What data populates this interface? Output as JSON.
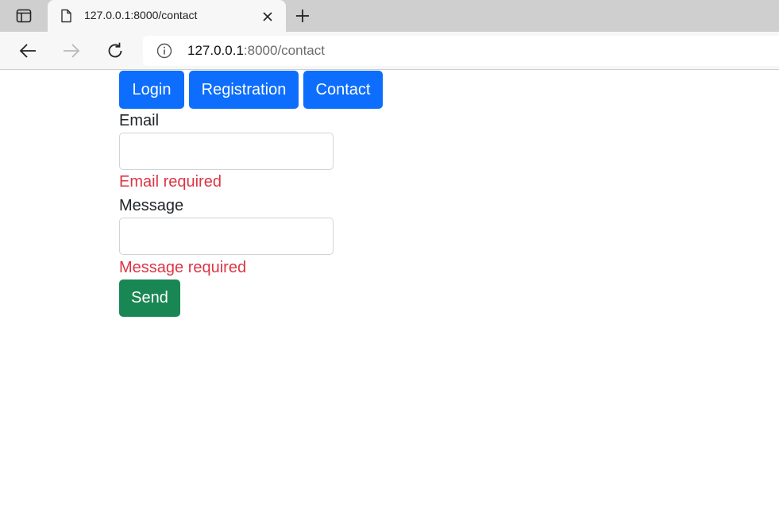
{
  "browser": {
    "tab": {
      "title": "127.0.0.1:8000/contact",
      "favicon": "page-icon"
    },
    "address": {
      "host": "127.0.0.1",
      "rest": ":8000/contact"
    },
    "icons": {
      "tab_actions": "tab-actions-icon",
      "close": "close-icon",
      "new_tab": "plus-icon",
      "back": "back-arrow-icon",
      "forward": "forward-arrow-icon",
      "reload": "reload-icon",
      "info": "info-icon"
    }
  },
  "nav": {
    "login": "Login",
    "registration": "Registration",
    "contact": "Contact"
  },
  "form": {
    "email_label": "Email",
    "email_value": "",
    "email_error": "Email required",
    "message_label": "Message",
    "message_value": "",
    "message_error": "Message required",
    "send_label": "Send"
  },
  "colors": {
    "primary": "#0d6efd",
    "success": "#198754",
    "error": "#dc3545"
  }
}
